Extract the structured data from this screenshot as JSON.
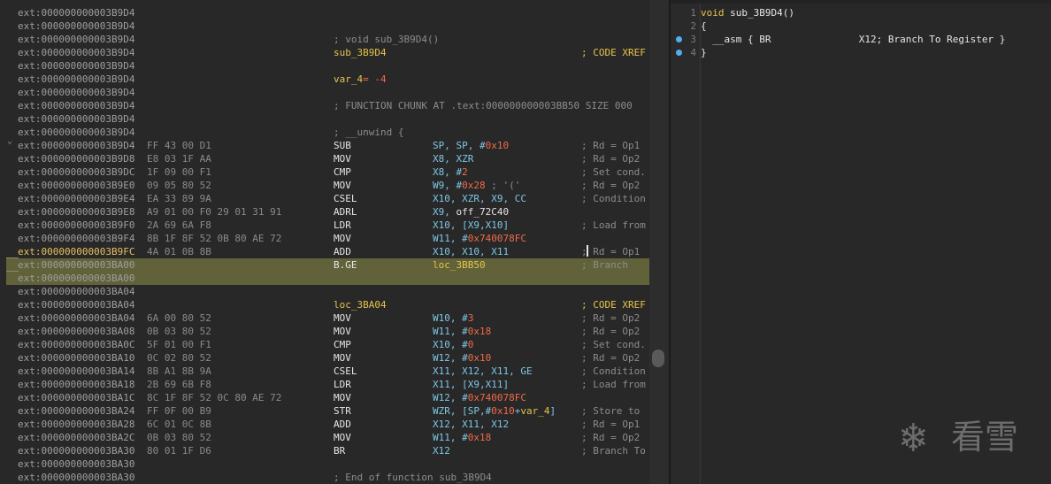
{
  "disasm": {
    "rows": [
      {
        "addr": "ext:000000000003B9D4"
      },
      {
        "addr": "ext:000000000003B9D4"
      },
      {
        "addr": "ext:000000000003B9D4",
        "comment": "; void sub_3B9D4()"
      },
      {
        "addr": "ext:000000000003B9D4",
        "label": "sub_3B9D4",
        "xref": "; CODE XREF"
      },
      {
        "addr": "ext:000000000003B9D4"
      },
      {
        "addr": "ext:000000000003B9D4",
        "label": "var_4",
        "label_tail": "= -4"
      },
      {
        "addr": "ext:000000000003B9D4"
      },
      {
        "addr": "ext:000000000003B9D4",
        "comment": "; FUNCTION CHUNK AT .text:000000000003BB50 SIZE 000"
      },
      {
        "addr": "ext:000000000003B9D4"
      },
      {
        "addr": "ext:000000000003B9D4",
        "comment": "; __unwind {"
      },
      {
        "addr": "ext:000000000003B9D4",
        "bytes": "FF 43 00 D1",
        "mnem": "SUB",
        "ops": [
          {
            "t": "SP, SP, #"
          },
          {
            "t": "0x10",
            "c": "num"
          }
        ],
        "rcmt": "; Rd = Op1"
      },
      {
        "addr": "ext:000000000003B9D8",
        "bytes": "E8 03 1F AA",
        "mnem": "MOV",
        "ops": [
          {
            "t": "X8, XZR"
          }
        ],
        "rcmt": "; Rd = Op2"
      },
      {
        "addr": "ext:000000000003B9DC",
        "bytes": "1F 09 00 F1",
        "mnem": "CMP",
        "ops": [
          {
            "t": "X8, #"
          },
          {
            "t": "2",
            "c": "num"
          }
        ],
        "rcmt": "; Set cond."
      },
      {
        "addr": "ext:000000000003B9E0",
        "bytes": "09 05 80 52",
        "mnem": "MOV",
        "ops": [
          {
            "t": "W9, #"
          },
          {
            "t": "0x28",
            "c": "num"
          },
          {
            "t": " ; '('",
            "c": "gry"
          }
        ],
        "rcmt": "; Rd = Op2"
      },
      {
        "addr": "ext:000000000003B9E4",
        "bytes": "EA 33 89 9A",
        "mnem": "CSEL",
        "ops": [
          {
            "t": "X10, XZR, X9, CC"
          }
        ],
        "rcmt": "; Condition"
      },
      {
        "addr": "ext:000000000003B9E8",
        "bytes": "A9 01 00 F0 29 01 31 91",
        "mnem": "ADRL",
        "ops": [
          {
            "t": "X9, "
          },
          {
            "t": "off_72C40",
            "c": "wht"
          }
        ],
        "rcmt": ""
      },
      {
        "addr": "ext:000000000003B9F0",
        "bytes": "2A 69 6A F8",
        "mnem": "LDR",
        "ops": [
          {
            "t": "X10, [X9,X10]"
          }
        ],
        "rcmt": "; Load from"
      },
      {
        "addr": "ext:000000000003B9F4",
        "bytes": "8B 1F 8F 52 0B 80 AE 72",
        "mnem": "MOV",
        "ops": [
          {
            "t": "W11, #"
          },
          {
            "t": "0x740078FC",
            "c": "num"
          }
        ],
        "rcmt": ""
      },
      {
        "addr": "ext:000000000003B9FC",
        "bytes": "4A 01 0B 8B",
        "mnem": "ADD",
        "ops": [
          {
            "t": "X10, X10, X11"
          }
        ],
        "rcmt": "; Rd = Op1",
        "cur": true
      },
      {
        "addr": "ext:000000000003BA00",
        "bytes": "",
        "mnem": "B.GE",
        "ops": [
          {
            "t": "loc_3BB50",
            "c": "yel"
          }
        ],
        "rcmt": "; Branch",
        "hl": true
      },
      {
        "addr": "ext:000000000003BA00",
        "hl": true
      },
      {
        "addr": "ext:000000000003BA04"
      },
      {
        "addr": "ext:000000000003BA04",
        "label": "loc_3BA04",
        "xref": "; CODE XREF"
      },
      {
        "addr": "ext:000000000003BA04",
        "bytes": "6A 00 80 52",
        "mnem": "MOV",
        "ops": [
          {
            "t": "W10, #"
          },
          {
            "t": "3",
            "c": "num"
          }
        ],
        "rcmt": "; Rd = Op2"
      },
      {
        "addr": "ext:000000000003BA08",
        "bytes": "0B 03 80 52",
        "mnem": "MOV",
        "ops": [
          {
            "t": "W11, #"
          },
          {
            "t": "0x18",
            "c": "num"
          }
        ],
        "rcmt": "; Rd = Op2"
      },
      {
        "addr": "ext:000000000003BA0C",
        "bytes": "5F 01 00 F1",
        "mnem": "CMP",
        "ops": [
          {
            "t": "X10, #"
          },
          {
            "t": "0",
            "c": "num"
          }
        ],
        "rcmt": "; Set cond."
      },
      {
        "addr": "ext:000000000003BA10",
        "bytes": "0C 02 80 52",
        "mnem": "MOV",
        "ops": [
          {
            "t": "W12, #"
          },
          {
            "t": "0x10",
            "c": "num"
          }
        ],
        "rcmt": "; Rd = Op2"
      },
      {
        "addr": "ext:000000000003BA14",
        "bytes": "8B A1 8B 9A",
        "mnem": "CSEL",
        "ops": [
          {
            "t": "X11, X12, X11, GE"
          }
        ],
        "rcmt": "; Condition"
      },
      {
        "addr": "ext:000000000003BA18",
        "bytes": "2B 69 6B F8",
        "mnem": "LDR",
        "ops": [
          {
            "t": "X11, [X9,X11]"
          }
        ],
        "rcmt": "; Load from"
      },
      {
        "addr": "ext:000000000003BA1C",
        "bytes": "8C 1F 8F 52 0C 80 AE 72",
        "mnem": "MOV",
        "ops": [
          {
            "t": "W12, #"
          },
          {
            "t": "0x740078FC",
            "c": "num"
          }
        ],
        "rcmt": ""
      },
      {
        "addr": "ext:000000000003BA24",
        "bytes": "FF 0F 00 B9",
        "mnem": "STR",
        "ops": [
          {
            "t": "WZR, [SP,#"
          },
          {
            "t": "0x10",
            "c": "num"
          },
          {
            "t": "+"
          },
          {
            "t": "var_4",
            "c": "yel"
          },
          {
            "t": "]"
          }
        ],
        "rcmt": "; Store to"
      },
      {
        "addr": "ext:000000000003BA28",
        "bytes": "6C 01 0C 8B",
        "mnem": "ADD",
        "ops": [
          {
            "t": "X12, X11, X12"
          }
        ],
        "rcmt": "; Rd = Op1"
      },
      {
        "addr": "ext:000000000003BA2C",
        "bytes": "0B 03 80 52",
        "mnem": "MOV",
        "ops": [
          {
            "t": "W11, #"
          },
          {
            "t": "0x18",
            "c": "num"
          }
        ],
        "rcmt": "; Rd = Op2"
      },
      {
        "addr": "ext:000000000003BA30",
        "bytes": "80 01 1F D6",
        "mnem": "BR",
        "ops": [
          {
            "t": "X12"
          }
        ],
        "rcmt": "; Branch To"
      },
      {
        "addr": "ext:000000000003BA30"
      },
      {
        "addr": "ext:000000000003BA30",
        "comment": "; End of function sub_3B9D4"
      }
    ]
  },
  "pseudocode": {
    "lines": [
      {
        "num": "1",
        "text": "void sub_3B9D4()",
        "bp": false
      },
      {
        "num": "2",
        "text": "{",
        "bp": false
      },
      {
        "num": "3",
        "text": "  __asm { BR               X12; Branch To Register }",
        "bp": true
      },
      {
        "num": "4",
        "text": "}",
        "bp": true
      }
    ]
  },
  "watermark": {
    "icon": "snowflake-logo",
    "text": "看雪"
  },
  "colors": {
    "bg": "#282828",
    "highlight": "#61623a",
    "number": "#f06a4a",
    "register": "#7ec7e6",
    "label": "#e6c34a",
    "comment": "#8c8c8c"
  }
}
